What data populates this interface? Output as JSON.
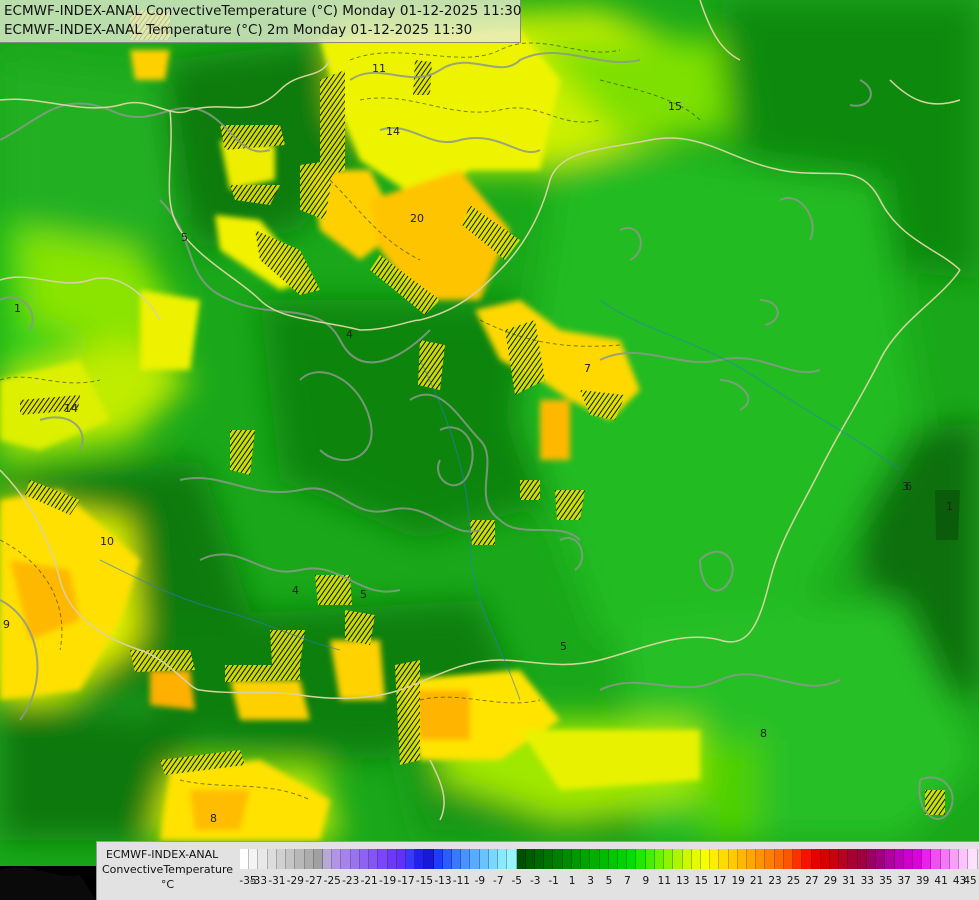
{
  "map": {
    "title_line1": "ECMWF-INDEX-ANAL ConvectiveTemperature (°C) Monday 01-12-2025 11:30",
    "title_line2": "ECMWF-INDEX-ANAL Temperature (°C) 2m Monday 01-12-2025 11:30",
    "contour_labels": [
      "11",
      "15",
      "14",
      "20",
      "5",
      "1",
      "4",
      "14",
      "10",
      "9",
      "6",
      "8",
      "3",
      "1",
      "5",
      "7",
      "5",
      "8",
      "4"
    ]
  },
  "legend": {
    "source": "ECMWF-INDEX-ANAL",
    "variable": "ConvectiveTemperature",
    "unit": "°C",
    "ticks": [
      "-35",
      "-33",
      "-31",
      "-29",
      "-27",
      "-25",
      "-23",
      "-21",
      "-19",
      "-17",
      "-15",
      "-13",
      "-11",
      "-9",
      "-7",
      "-5",
      "-3",
      "-1",
      "1",
      "3",
      "5",
      "7",
      "9",
      "11",
      "13",
      "15",
      "17",
      "19",
      "21",
      "23",
      "25",
      "27",
      "29",
      "31",
      "33",
      "35",
      "37",
      "39",
      "41",
      "43",
      "45"
    ],
    "colors": [
      "#ffffff",
      "#f4f4f4",
      "#e8e8e8",
      "#dcdcdc",
      "#d0d0d0",
      "#c4c4c4",
      "#b8b8b8",
      "#acacac",
      "#a0a0a0",
      "#b9a7d8",
      "#b194e6",
      "#a583ea",
      "#9a73ee",
      "#8f63f2",
      "#8554f5",
      "#7a46f8",
      "#6e38fb",
      "#6230fb",
      "#3838ff",
      "#2020f0",
      "#1818d8",
      "#1e3cff",
      "#2a5cff",
      "#3a78ff",
      "#4a92ff",
      "#5aaaff",
      "#6ac2ff",
      "#7ad8ff",
      "#8ae8ff",
      "#9af4ff",
      "#005000",
      "#005c00",
      "#006800",
      "#007400",
      "#008000",
      "#008c00",
      "#009800",
      "#00a400",
      "#00b000",
      "#00bc00",
      "#00c800",
      "#00d400",
      "#00e000",
      "#20e800",
      "#48ee00",
      "#6cf200",
      "#8ef400",
      "#aef600",
      "#ccf800",
      "#e6fa00",
      "#f8ff00",
      "#ffee00",
      "#ffdc00",
      "#ffca00",
      "#ffb800",
      "#ffa600",
      "#ff9400",
      "#ff8000",
      "#ff6a00",
      "#ff5400",
      "#ff3000",
      "#f81000",
      "#e80000",
      "#d80000",
      "#c80010",
      "#b80020",
      "#a80030",
      "#a00040",
      "#9c0060",
      "#a00080",
      "#b000a0",
      "#c000b8",
      "#d000cc",
      "#e000dc",
      "#ec20ec",
      "#f050f0",
      "#f478f4",
      "#f8a0f8",
      "#fcc4fc",
      "#ffe0ff"
    ]
  }
}
